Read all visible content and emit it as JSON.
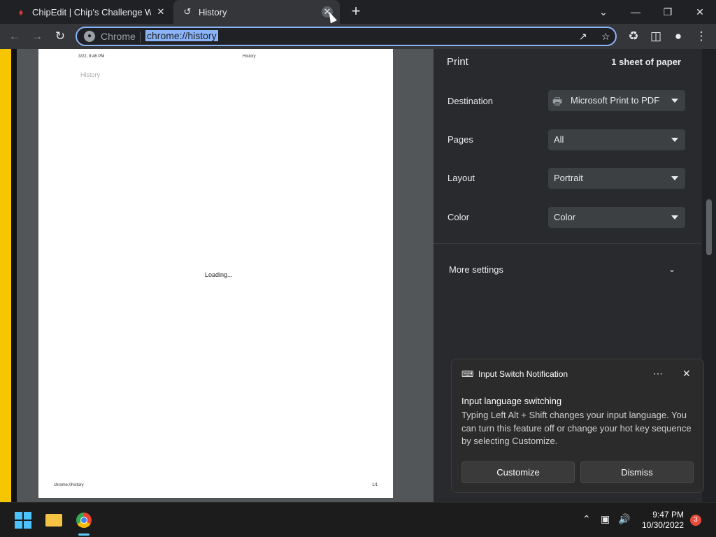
{
  "tabs": [
    {
      "title": "ChipEdit | Chip's Challenge Wiki | F",
      "favicon": "flame-icon"
    },
    {
      "title": "History",
      "favicon": "history-icon"
    }
  ],
  "window_controls": [
    "chevron-down-icon",
    "minimize-icon",
    "restore-icon",
    "close-icon"
  ],
  "omnibox": {
    "chip": "Chrome",
    "url": "chrome://history"
  },
  "preview": {
    "header_left": "3/22, 9:46 PM",
    "header_right": "History",
    "title": "History",
    "loading": "Loading...",
    "footer_left": "chrome://history",
    "footer_right": "1/1"
  },
  "print": {
    "title": "Print",
    "sheets": "1 sheet of paper",
    "rows": [
      {
        "label": "Destination",
        "value": "Microsoft Print to PDF"
      },
      {
        "label": "Pages",
        "value": "All"
      },
      {
        "label": "Layout",
        "value": "Portrait"
      },
      {
        "label": "Color",
        "value": "Color"
      }
    ],
    "more_settings": "More settings"
  },
  "notification": {
    "app": "Input Switch Notification",
    "heading": "Input language switching",
    "body": "Typing Left Alt + Shift changes your input language. You can turn this feature off or change your hot key sequence by selecting Customize.",
    "customize": "Customize",
    "dismiss": "Dismiss"
  },
  "taskbar": {
    "time": "9:47 PM",
    "date": "10/30/2022",
    "badge": "3"
  },
  "colors": {
    "accent": "#8ab4f8",
    "taskbar_accent": "#60cdff",
    "badge": "#e74c3c"
  }
}
